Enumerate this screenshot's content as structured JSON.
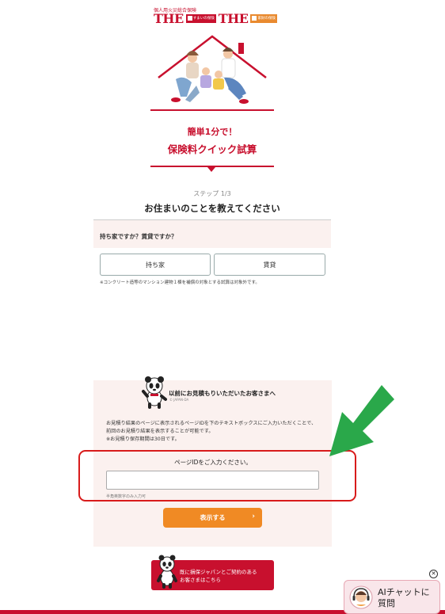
{
  "header": {
    "subtitle": "個人用火災総合保険",
    "the1": "THE",
    "tag1": "すまいの保険",
    "the2": "THE",
    "tag2": "家財の保険"
  },
  "lead": {
    "line1": "簡単1分で！",
    "line2": "保険料クイック試算"
  },
  "step": "ステップ 1/3",
  "question": {
    "title": "お住まいのことを教えてください",
    "label": "持ち家ですか？賃貸ですか？",
    "options": [
      "持ち家",
      "賃貸"
    ],
    "note": "※コンクリート造等のマンション建物１棟を補償の対象とする試算は対象外です。"
  },
  "retrieve": {
    "title": "以前にお見積もりいただいたお客さまへ",
    "mascot_caption": "© JAPAN-DA",
    "desc1": "お見積り結果のページに表示されるページIDを下のテキストボックスにご入力いただくことで、前回のお見積り結果を表示することが可能です。",
    "desc2": "※お見積り保存期間は30日です。",
    "input_label": "ページIDをご入力ください。",
    "input_value": "",
    "input_hint": "半角英数字のみ入力可",
    "button": "表示する"
  },
  "contract": {
    "line1": "既に損保ジャパンとご契約のある",
    "line2": "お客さまはこちら"
  },
  "ai_chat": {
    "line1": "AIチャットに",
    "line2": "質問",
    "close": "✕"
  },
  "colors": {
    "brand_red": "#c8102e",
    "orange": "#f08a24",
    "arrow_green": "#2aa84a",
    "highlight_red": "#d81b1b"
  }
}
